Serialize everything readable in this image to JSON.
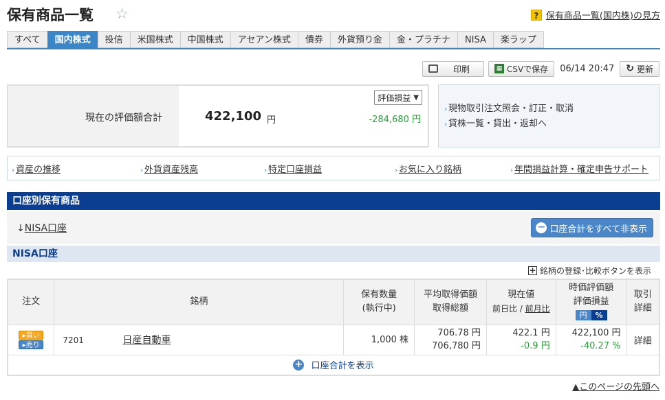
{
  "header": {
    "title": "保有商品一覧",
    "help_icon": "?",
    "help_link": "保有商品一覧(国内株)の見方"
  },
  "tabs": [
    {
      "label": "すべて"
    },
    {
      "label": "国内株式",
      "active": true
    },
    {
      "label": "投信"
    },
    {
      "label": "米国株式"
    },
    {
      "label": "中国株式"
    },
    {
      "label": "アセアン株式"
    },
    {
      "label": "債券"
    },
    {
      "label": "外貨預り金"
    },
    {
      "label": "金・プラチナ"
    },
    {
      "label": "NISA"
    },
    {
      "label": "楽ラップ"
    }
  ],
  "toolbar": {
    "print_label": "印刷",
    "csv_label": "CSVで保存",
    "timestamp": "06/14 20:47",
    "refresh_label": "更新"
  },
  "summary": {
    "label": "現在の評価額合計",
    "amount": "422,100",
    "unit": "円",
    "select_value": "評価損益",
    "profit_loss": "-284,680 円"
  },
  "side_links": [
    "現物取引注文照会・訂正・取消",
    "貸株一覧・貸出・返却へ"
  ],
  "quick_links": [
    "資産の推移",
    "外貨資産残高",
    "特定口座損益",
    "お気に入り銘柄",
    "年間損益計算・確定申告サポート"
  ],
  "section": {
    "title": "口座別保有商品",
    "nisa_anchor": "NISA口座",
    "hide_all_label": "口座合計をすべて非表示",
    "account_title": "NISA口座",
    "compare_toggle": "銘柄の登録･比較ボタンを表示"
  },
  "table": {
    "headers": {
      "order": "注文",
      "name": "銘柄",
      "qty_1": "保有数量",
      "qty_2": "(執行中)",
      "avg_1": "平均取得価額",
      "avg_2": "取得総額",
      "price_1": "現在値",
      "price_2a": "前日比",
      "price_2b": "前月比",
      "eval_1": "時価評価額",
      "eval_2": "評価損益",
      "unit_yen": "円",
      "unit_pct": "%",
      "detail_1": "取引",
      "detail_2": "詳細"
    },
    "rows": [
      {
        "buy": "買い",
        "sell": "売り",
        "code": "7201",
        "name": "日産自動車",
        "qty": "1,000 株",
        "avg_price": "706.78 円",
        "total_cost": "706,780 円",
        "current_price": "422.1 円",
        "day_change": "-0.9 円",
        "market_value": "422,100 円",
        "pl_pct": "-40.27 %",
        "detail": "詳細"
      }
    ],
    "show_total_label": "口座合計を表示"
  },
  "footer": {
    "page_top": "▲このページの先頭へ"
  }
}
